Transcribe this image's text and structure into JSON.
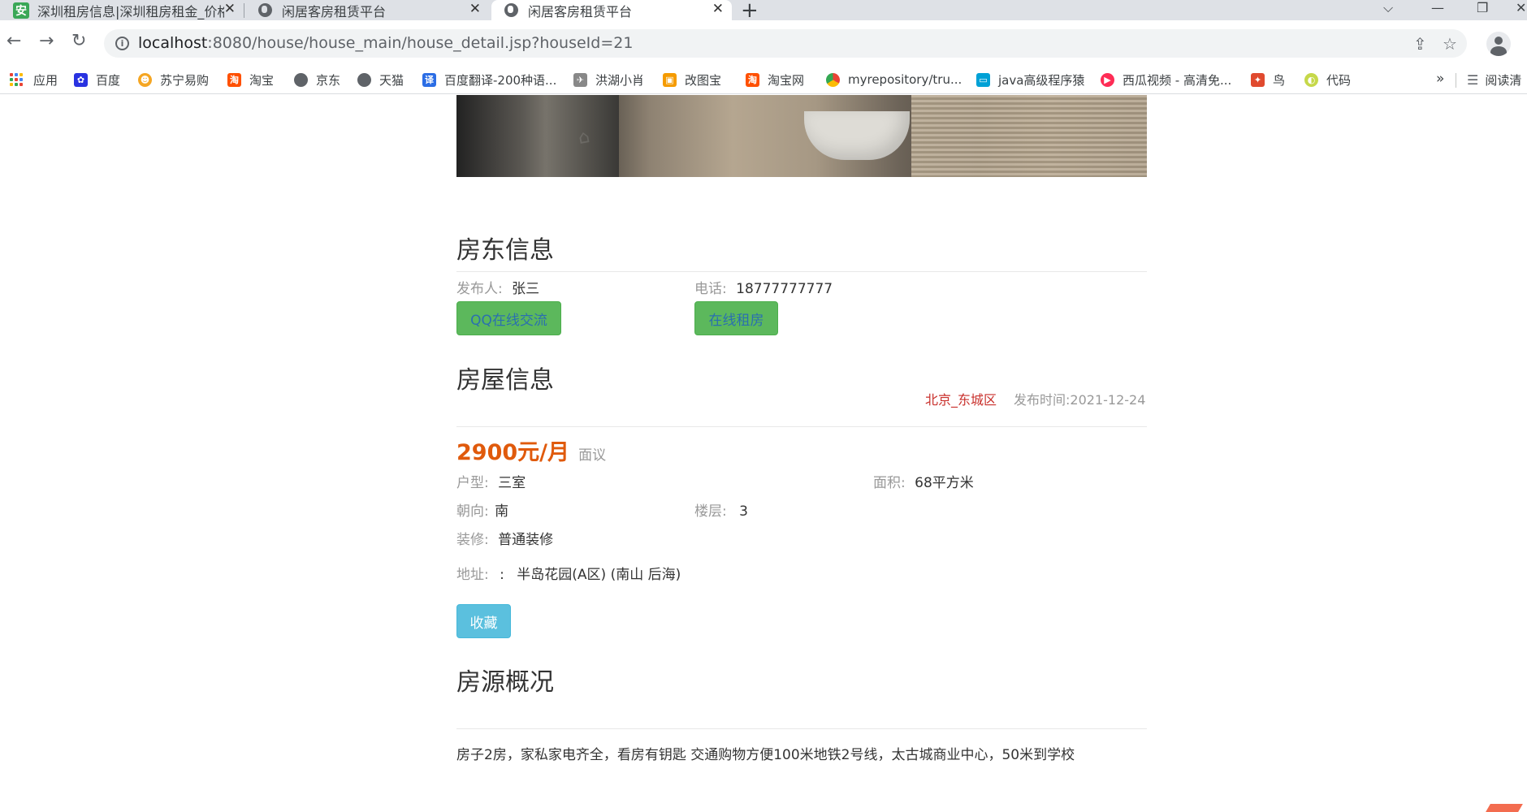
{
  "browser": {
    "tabs": [
      {
        "title": "深圳租房信息|深圳租房租金_价格",
        "icon": "anjuke-favicon",
        "active": false
      },
      {
        "title": "闲居客房租赁平台",
        "icon": "globe-icon",
        "active": false
      },
      {
        "title": "闲居客房租赁平台",
        "icon": "globe-icon",
        "active": true
      }
    ],
    "url_host": "localhost",
    "url_path": ":8080/house/house_main/house_detail.jsp?houseId=21",
    "bookmarks": [
      {
        "label": "应用",
        "icon": "apps-icon"
      },
      {
        "label": "百度",
        "icon": "baidu-icon",
        "color": "#2932e1"
      },
      {
        "label": "苏宁易购",
        "icon": "suning-icon",
        "color": "#f5a623"
      },
      {
        "label": "淘宝",
        "icon": "taobao-icon",
        "color": "#ff5000"
      },
      {
        "label": "京东",
        "icon": "globe-icon",
        "color": "#5f6368"
      },
      {
        "label": "天猫",
        "icon": "globe-icon",
        "color": "#5f6368"
      },
      {
        "label": "百度翻译-200种语...",
        "icon": "translate-icon",
        "color": "#2b6de5"
      },
      {
        "label": "洪湖小肖",
        "icon": "bird-icon",
        "color": "#888888"
      },
      {
        "label": "改图宝",
        "icon": "gaitubao-icon",
        "color": "#f59b00"
      },
      {
        "label": "淘宝网",
        "icon": "taobao-icon",
        "color": "#ff5000"
      },
      {
        "label": "myrepository/tru...",
        "icon": "chrome-icon",
        "color": "#34a853"
      },
      {
        "label": "java高级程序猿",
        "icon": "bilibili-icon",
        "color": "#00a1d6"
      },
      {
        "label": "西瓜视频 - 高清免...",
        "icon": "xigua-icon",
        "color": "#fe2c55"
      },
      {
        "label": "鸟",
        "icon": "bird-icon",
        "color": "#e04a2f"
      },
      {
        "label": "代码",
        "icon": "code-icon",
        "color": "#c6d84a"
      }
    ],
    "bookmarks_more": "»",
    "reading_list": "阅读清"
  },
  "landlord": {
    "title": "房东信息",
    "publisher_label": "发布人:",
    "publisher": "张三",
    "phone_label": "电话:",
    "phone": "18777777777",
    "qq_button": "QQ在线交流",
    "rent_button": "在线租房"
  },
  "house": {
    "title": "房屋信息",
    "region": "北京_东城区",
    "publish_label": "发布时间:",
    "publish_date": "2021-12-24",
    "price": "2900元/月",
    "price_note": "面议",
    "layout_label": "户型:",
    "layout": "三室",
    "area_label": "面积:",
    "area": "68平方米",
    "orientation_label": "朝向:",
    "orientation": "南",
    "floor_label": "楼层:",
    "floor": "3",
    "decoration_label": "装修:",
    "decoration": "普通装修",
    "address_label": "地址:",
    "address_sep": ":",
    "address": "半岛花园(A区) (南山 后海)",
    "favorite_button": "收藏"
  },
  "overview": {
    "title": "房源概况",
    "text": "房子2房，家私家电齐全，看房有钥匙 交通购物方便100米地铁2号线，太古城商业中心，50米到学校"
  }
}
